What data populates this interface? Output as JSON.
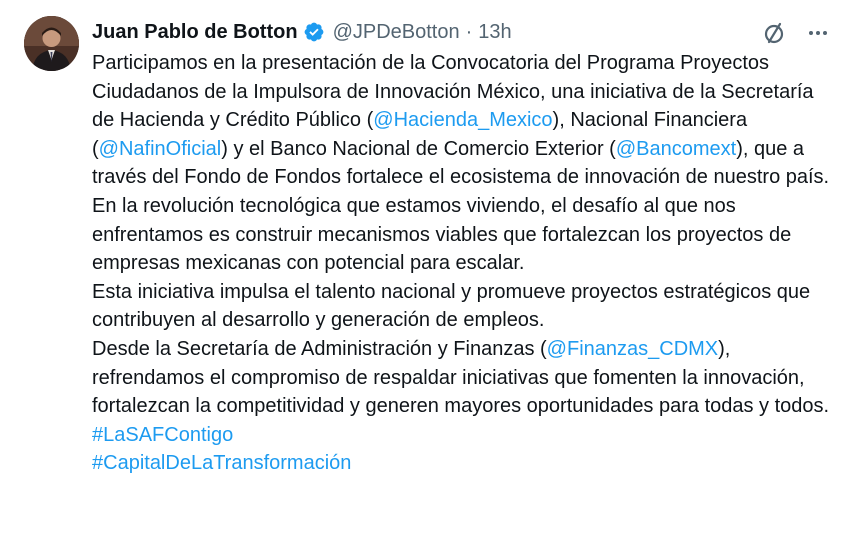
{
  "author": {
    "name": "Juan Pablo de Botton",
    "handle": "@JPDeBotton",
    "separator": "·",
    "time": "13h"
  },
  "icons": {
    "avatar": "profile-photo",
    "verified": "verified-badge-icon",
    "grok": "slash-circle-icon",
    "more": "more-icon"
  },
  "colors": {
    "link": "#1d9bf0",
    "text": "#0f1419",
    "muted": "#536471"
  },
  "tweet": {
    "p1": {
      "t1": "Participamos en la presentación de la Convocatoria del Programa Proyectos Ciudadanos de la Impulsora de Innovación México, una iniciativa de la Secretaría de Hacienda y Crédito Público (",
      "m1": "@Hacienda_Mexico",
      "t2": "), Nacional Financiera (",
      "m2": "@NafinOficial",
      "t3": ") y el Banco Nacional de Comercio Exterior (",
      "m3": "@Bancomext",
      "t4": "), que a través del Fondo de Fondos fortalece el ecosistema de innovación de nuestro país."
    },
    "p2": "En la revolución tecnológica que estamos viviendo, el desafío al que nos enfrentamos es construir mecanismos viables que fortalezcan los proyectos de empresas mexicanas con potencial para escalar.",
    "p3": "Esta iniciativa impulsa el talento nacional y promueve proyectos estratégicos que contribuyen al desarrollo y generación de empleos.",
    "p4": {
      "t1": "Desde la Secretaría de Administración y Finanzas (",
      "m1": "@Finanzas_CDMX",
      "t2": "), refrendamos el compromiso de respaldar iniciativas que fomenten la innovación, fortalezcan la competitividad y generen mayores oportunidades para todas y todos."
    },
    "hashtags": [
      "#LaSAFContigo",
      "#CapitalDeLaTransformación"
    ]
  }
}
